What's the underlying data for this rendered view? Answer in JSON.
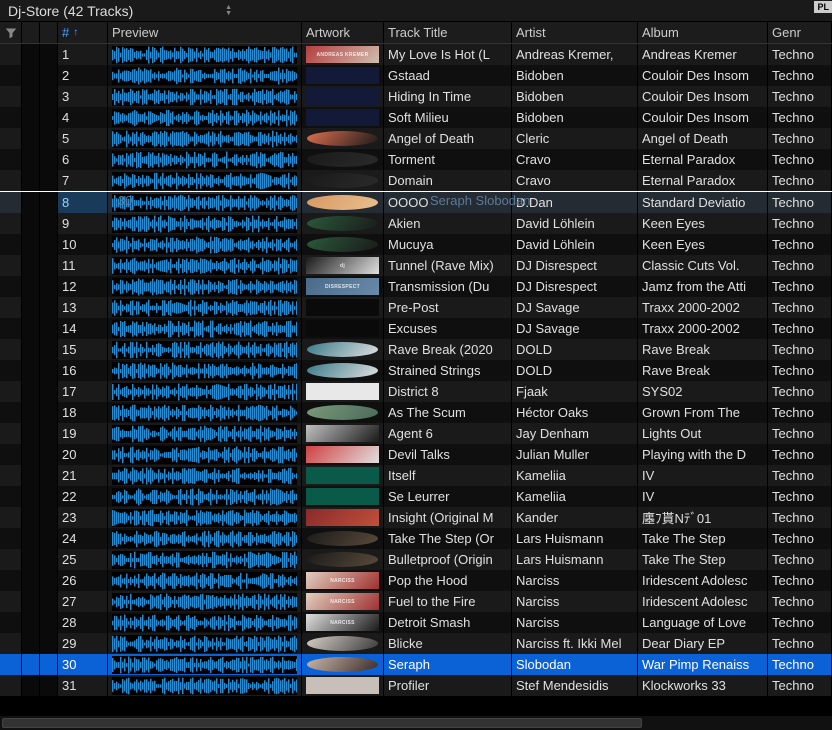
{
  "topbar": {
    "playlist_label": "Dj-Store (42 Tracks)",
    "pl_button": "PL"
  },
  "columns": {
    "num": "#",
    "preview": "Preview",
    "artwork": "Artwork",
    "title": "Track Title",
    "artist": "Artist",
    "album": "Album",
    "genre": "Genr"
  },
  "sort_arrow": "↑",
  "selected_index": 30,
  "playing_index": 8,
  "ghost_row": {
    "index": 8,
    "left_text": "30",
    "right_text": "Seraph    Slobodan"
  },
  "tracks": [
    {
      "n": 1,
      "title": "My Love Is Hot (L",
      "artist": "Andreas Kremer,",
      "album": "Andreas Kremer",
      "genre": "Techno",
      "art": "#b33d3f",
      "art2": "#d0bfae",
      "label": "ANDREAS KREMER"
    },
    {
      "n": 2,
      "title": "Gstaad",
      "artist": "Bidoben",
      "album": "Couloir Des Insom",
      "genre": "Techno",
      "art": "#121a38",
      "art2": "#121a38"
    },
    {
      "n": 3,
      "title": "Hiding In Time",
      "artist": "Bidoben",
      "album": "Couloir Des Insom",
      "genre": "Techno",
      "art": "#121a38",
      "art2": "#121a38"
    },
    {
      "n": 4,
      "title": "Soft Milieu",
      "artist": "Bidoben",
      "album": "Couloir Des Insom",
      "genre": "Techno",
      "art": "#121a38",
      "art2": "#121a38"
    },
    {
      "n": 5,
      "title": "Angel of Death",
      "artist": "Cleric",
      "album": "Angel of Death",
      "genre": "Techno",
      "art": "#e07050",
      "art2": "#1a1a1a",
      "round": true
    },
    {
      "n": 6,
      "title": "Torment",
      "artist": "Cravo",
      "album": "Eternal Paradox",
      "genre": "Techno",
      "art": "#1a1a1a",
      "art2": "#2a2a2a",
      "round": true
    },
    {
      "n": 7,
      "title": "Domain",
      "artist": "Cravo",
      "album": "Eternal Paradox",
      "genre": "Techno",
      "art": "#1a1a1a",
      "art2": "#2a2a2a",
      "round": true
    },
    {
      "n": 8,
      "title": "OOOO",
      "artist": "D.Dan",
      "album": "Standard Deviatio",
      "genre": "Techno",
      "art": "#d89860",
      "art2": "#e8c090",
      "round": true
    },
    {
      "n": 9,
      "title": "Akien",
      "artist": "David Löhlein",
      "album": "Keen Eyes",
      "genre": "Techno",
      "art": "#2a5a3a",
      "art2": "#1a1a1a",
      "round": true
    },
    {
      "n": 10,
      "title": "Mucuya",
      "artist": "David Löhlein",
      "album": "Keen Eyes",
      "genre": "Techno",
      "art": "#2a5a3a",
      "art2": "#1a1a1a",
      "round": true
    },
    {
      "n": 11,
      "title": "Tunnel (Rave Mix)",
      "artist": "DJ Disrespect",
      "album": "Classic Cuts Vol.",
      "genre": "Techno",
      "art": "#1a1a1a",
      "art2": "#e0e0e0",
      "label": "dj"
    },
    {
      "n": 12,
      "title": "Transmission (Du",
      "artist": "DJ Disrespect",
      "album": "Jamz from the Atti",
      "genre": "Techno",
      "art": "#4a6a8a",
      "art2": "#6a8aaa",
      "label": "DISRESPECT"
    },
    {
      "n": 13,
      "title": "Pre-Post",
      "artist": "DJ Savage",
      "album": "Traxx 2000-2002",
      "genre": "Techno",
      "art": "#0a0a0a",
      "art2": "#0a0a0a"
    },
    {
      "n": 14,
      "title": "Excuses",
      "artist": "DJ Savage",
      "album": "Traxx 2000-2002",
      "genre": "Techno",
      "art": "#0a0a0a",
      "art2": "#0a0a0a"
    },
    {
      "n": 15,
      "title": "Rave Break (2020",
      "artist": "DOLD",
      "album": "Rave Break",
      "genre": "Techno",
      "art": "#3a7a8a",
      "art2": "#e0e0e0",
      "round": true
    },
    {
      "n": 16,
      "title": "Strained Strings",
      "artist": "DOLD",
      "album": "Rave Break",
      "genre": "Techno",
      "art": "#3a7a8a",
      "art2": "#e0e0e0",
      "round": true
    },
    {
      "n": 17,
      "title": "District 8",
      "artist": "Fjaak",
      "album": "SYS02",
      "genre": "Techno",
      "art": "#e8e8e8",
      "art2": "#e8e8e8"
    },
    {
      "n": 18,
      "title": "As The Scum",
      "artist": "Héctor Oaks",
      "album": "Grown From The",
      "genre": "Techno",
      "art": "#7a9a7a",
      "art2": "#4a6a5a",
      "round": true
    },
    {
      "n": 19,
      "title": "Agent 6",
      "artist": "Jay Denham",
      "album": "Lights Out",
      "genre": "Techno",
      "art": "#c0c0c0",
      "art2": "#1a1a1a"
    },
    {
      "n": 20,
      "title": "Devil Talks",
      "artist": "Julian Muller",
      "album": "Playing with the D",
      "genre": "Techno",
      "art": "#d04040",
      "art2": "#e0e0e0"
    },
    {
      "n": 21,
      "title": "Itself",
      "artist": "Kameliia",
      "album": "IV",
      "genre": "Techno",
      "art": "#0a5a4a",
      "art2": "#0a5a4a"
    },
    {
      "n": 22,
      "title": "Se Leurrer",
      "artist": "Kameliia",
      "album": "IV",
      "genre": "Techno",
      "art": "#0a5a4a",
      "art2": "#0a5a4a"
    },
    {
      "n": 23,
      "title": "Insight (Original M",
      "artist": "Kander",
      "album": "廛ﾌ貰Nﾃﾞ01",
      "genre": "Techno",
      "art": "#8a2a2a",
      "art2": "#c0503a"
    },
    {
      "n": 24,
      "title": "Take The Step (Or",
      "artist": "Lars Huismann",
      "album": "Take The Step",
      "genre": "Techno",
      "art": "#1a1a1a",
      "art2": "#5a4a3a",
      "round": true
    },
    {
      "n": 25,
      "title": "Bulletproof (Origin",
      "artist": "Lars Huismann",
      "album": "Take The Step",
      "genre": "Techno",
      "art": "#1a1a1a",
      "art2": "#5a4a3a",
      "round": true
    },
    {
      "n": 26,
      "title": "Pop the Hood",
      "artist": "Narciss",
      "album": "Iridescent Adolesc",
      "genre": "Techno",
      "art": "#e0d0c0",
      "art2": "#a03030",
      "label": "NARCISS"
    },
    {
      "n": 27,
      "title": "Fuel to the Fire",
      "artist": "Narciss",
      "album": "Iridescent Adolesc",
      "genre": "Techno",
      "art": "#e0d0c0",
      "art2": "#a03030",
      "label": "NARCISS"
    },
    {
      "n": 28,
      "title": "Detroit Smash",
      "artist": "Narciss",
      "album": "Language of Love",
      "genre": "Techno",
      "art": "#e0e0e0",
      "art2": "#1a1a1a",
      "label": "NARCISS"
    },
    {
      "n": 29,
      "title": "Blicke",
      "artist": "Narciss ft. Ikki Mel",
      "album": "Dear Diary EP",
      "genre": "Techno",
      "art": "#d8d0c8",
      "art2": "#3a3a3a",
      "round": true
    },
    {
      "n": 30,
      "title": "Seraph",
      "artist": "Slobodan",
      "album": "War Pimp Renaiss",
      "genre": "Techno",
      "art": "#c8b8a8",
      "art2": "#3a2a2a",
      "round": true
    },
    {
      "n": 31,
      "title": "Profiler",
      "artist": "Stef Mendesidis",
      "album": "Klockworks 33",
      "genre": "Techno",
      "art": "#c8c0b8",
      "art2": "#c8c0b8"
    }
  ]
}
